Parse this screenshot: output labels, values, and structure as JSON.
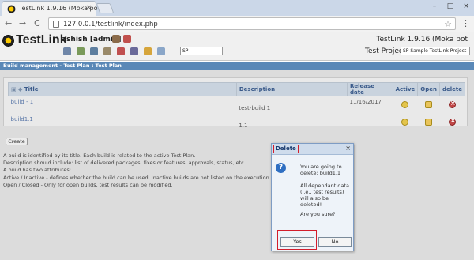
{
  "browser": {
    "tab_title": "TestLink 1.9.16 (Moka po",
    "tab_close": "×",
    "url": "127.0.0.1/testlink/index.php",
    "nav_back": "←",
    "nav_forward": "→",
    "nav_reload": "C",
    "star": "☆",
    "menu": "⋮",
    "win_min": "–",
    "win_max": "□",
    "win_close": "×"
  },
  "header": {
    "logo": "TestLink",
    "username": "ashish [admin]",
    "version": "TestLink 1.9.16 (Moka pot",
    "sp_value": "SP-",
    "test_project_label": "Test Project",
    "test_project_value": "SP Sample TestLink Project",
    "colors": {
      "logo_yellow": "#ffcc00",
      "bar_blue": "#5a88b7"
    }
  },
  "page": {
    "title": "Build management - Test Plan : Test Plan",
    "columns": [
      "Title",
      "Description",
      "Release date",
      "Active",
      "Open",
      "delete"
    ],
    "rows": [
      {
        "title": "build - 1",
        "description": "test-build 1",
        "release_date": "11/16/2017"
      },
      {
        "title": "build1.1",
        "description": "1.1",
        "release_date": ""
      }
    ],
    "create_label": "Create",
    "help_lines": [
      "A build is identified by its title. Each build is related to the active Test Plan.",
      "Description should include: list of delivered packages, fixes or features, approvals, status, etc.",
      "A build has two attributes:",
      "Active / Inactive - defines whether the build can be used. Inactive builds are not listed on the execution",
      "Open / Closed - Only for open builds, test results can be modified."
    ]
  },
  "dialog": {
    "title": "Delete",
    "close": "×",
    "icon": "?",
    "message1": "You are going to delete: build1.1",
    "message2": "All dependant data (i.e., test results) will also be deleted!",
    "message3": "Are you sure?",
    "yes_label": "Yes",
    "no_label": "No",
    "highlight_color": "#d31d2b"
  }
}
